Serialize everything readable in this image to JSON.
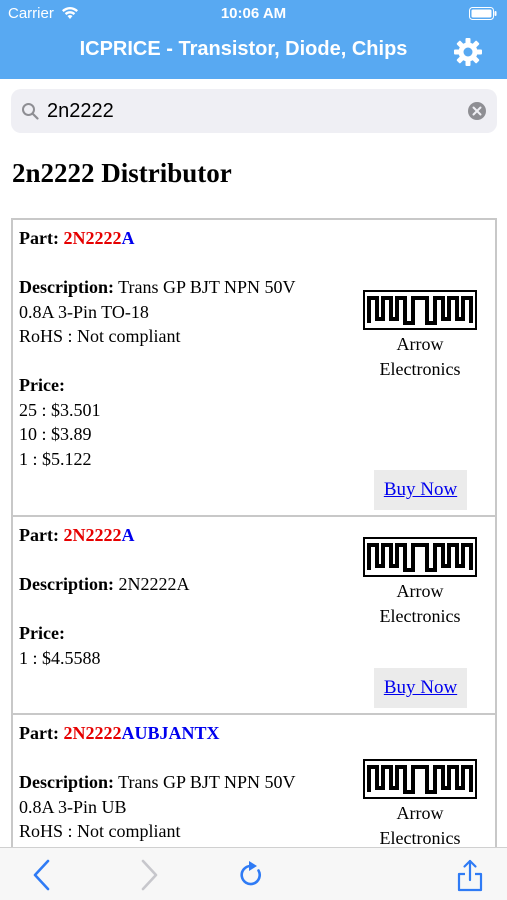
{
  "status_bar": {
    "carrier": "Carrier",
    "time": "10:06 AM"
  },
  "nav": {
    "title": "ICPRICE - Transistor, Diode, Chips",
    "settings_icon": "gear-icon"
  },
  "search": {
    "value": "2n2222",
    "placeholder": ""
  },
  "page_title": "2n2222 Distributor",
  "labels": {
    "part": "Part:",
    "description": "Description:",
    "price": "Price:",
    "rohs": "RoHS : Not compliant",
    "buy": "Buy Now"
  },
  "results": [
    {
      "part_match": "2N2222",
      "part_rest": "A",
      "description_line1": "Trans GP BJT NPN 50V",
      "description_line2": "0.8A 3-Pin TO-18",
      "rohs": "RoHS : Not compliant",
      "prices": [
        "25 : $3.501",
        "10 : $3.89",
        "1 : $5.122"
      ],
      "distributor_line1": "Arrow",
      "distributor_line2": "Electronics"
    },
    {
      "part_match": "2N2222",
      "part_rest": "A",
      "description_line1": "2N2222A",
      "prices": [
        "1 : $4.5588"
      ],
      "distributor_line1": "Arrow",
      "distributor_line2": "Electronics"
    },
    {
      "part_match": "2N2222",
      "part_rest": "AUBJANTX",
      "description_line1": "Trans GP BJT NPN 50V",
      "description_line2": "0.8A 3-Pin UB",
      "rohs": "RoHS : Not compliant",
      "distributor_line1": "Arrow",
      "distributor_line2": "Electronics"
    }
  ],
  "toolbar": {
    "back": "chevron-left-icon",
    "forward": "chevron-right-icon",
    "reload": "reload-icon",
    "share": "share-icon"
  },
  "colors": {
    "nav_bg": "#58a9f2",
    "part_match": "#e60000",
    "part_rest": "#0000ee",
    "link": "#0000ee"
  }
}
